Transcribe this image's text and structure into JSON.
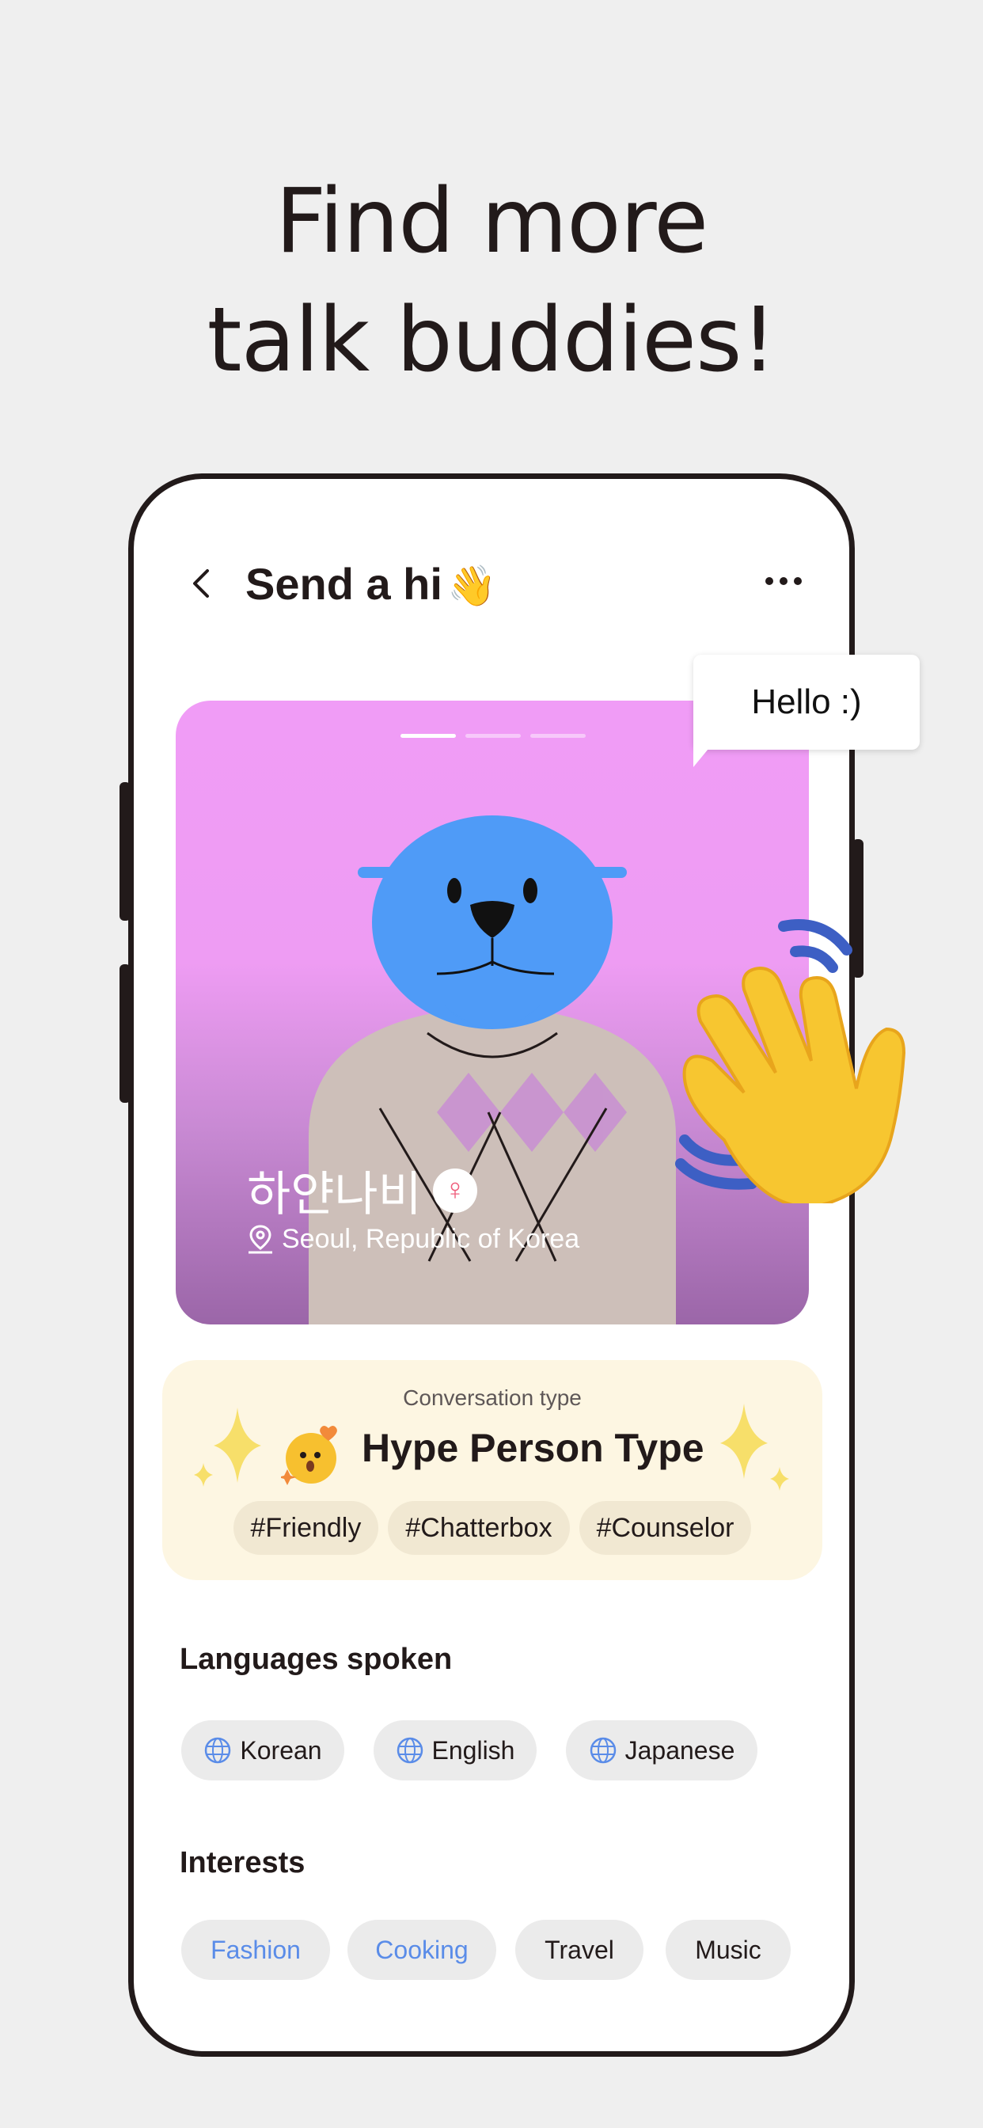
{
  "headline": {
    "line1": "Find more",
    "line2": "talk buddies!"
  },
  "nav": {
    "title": "Send a hi",
    "back_icon": "chevron-left-icon",
    "more_icon": "more-horizontal-icon",
    "title_emoji": "👋"
  },
  "speech_bubble": {
    "text": "Hello :)"
  },
  "profile": {
    "name": "하얀나비",
    "gender_symbol": "♀",
    "location": "Seoul, Republic of Korea",
    "photo_pages": 3,
    "active_photo": 1
  },
  "conversation": {
    "label": "Conversation type",
    "type": "Hype Person Type",
    "tags": [
      "#Friendly",
      "#Chatterbox",
      "#Counselor"
    ]
  },
  "languages": {
    "title": "Languages spoken",
    "items": [
      "Korean",
      "English",
      "Japanese"
    ]
  },
  "interests": {
    "title": "Interests",
    "items": [
      {
        "label": "Fashion",
        "highlighted": true
      },
      {
        "label": "Cooking",
        "highlighted": true
      },
      {
        "label": "Travel",
        "highlighted": false
      },
      {
        "label": "Music",
        "highlighted": false
      }
    ]
  },
  "colors": {
    "background": "#efefef",
    "text_primary": "#221a1a",
    "photo_pink": "#f09cf6",
    "mascot_blue": "#4f9bf7",
    "conversation_bg": "#fdf6e2",
    "chip_bg": "#ebebeb",
    "highlight_blue": "#5a8ce8",
    "gender_pink": "#ef5d7b"
  }
}
